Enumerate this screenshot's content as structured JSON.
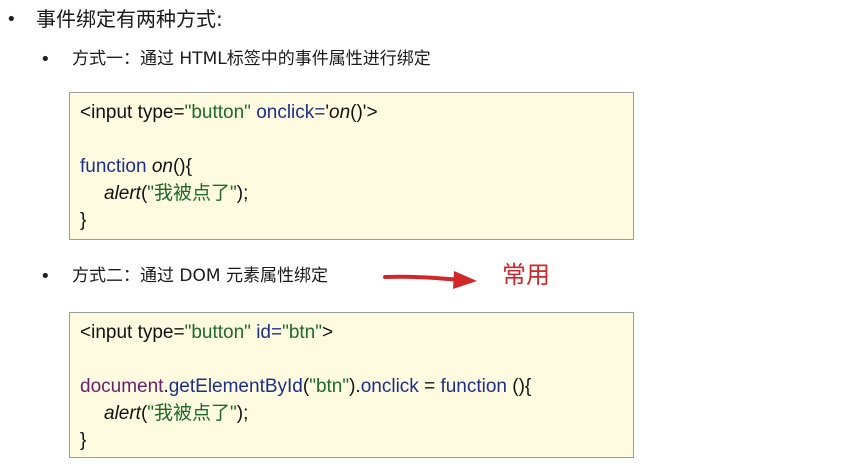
{
  "heading": "事件绑定有两种方式:",
  "method1": {
    "title": "方式一：通过 HTML标签中的事件属性进行绑定",
    "code": {
      "l1_a": "<input type=",
      "l1_b": "\"button\"",
      "l1_c": " onclick=",
      "l1_d": "'",
      "l1_e": "on",
      "l1_f": "()'",
      "l1_g": ">",
      "l3_a": "function ",
      "l3_b": "on",
      "l3_c": "(){",
      "l4_a": "alert",
      "l4_b": "(",
      "l4_c": "\"我被点了\"",
      "l4_d": ");",
      "l5": "}"
    }
  },
  "method2": {
    "title": "方式二：通过 DOM 元素属性绑定",
    "tag": "常用",
    "code": {
      "l1_a": "<input type=",
      "l1_b": "\"button\"",
      "l1_c": " id=",
      "l1_d": "\"btn\"",
      "l1_e": ">",
      "l3_a": "document",
      "l3_b": ".",
      "l3_c": "getElementById",
      "l3_d": "(",
      "l3_e": "\"btn\"",
      "l3_f": ").",
      "l3_g": "onclick",
      "l3_h": " = ",
      "l3_i": "function ",
      "l3_j": "(){",
      "l4_a": "alert",
      "l4_b": "(",
      "l4_c": "\"我被点了\"",
      "l4_d": ");",
      "l5": "}"
    }
  },
  "icons": {
    "bullet": "bullet-dot",
    "arrow": "right-arrow-icon"
  },
  "colors": {
    "code_background": "#fffbe0",
    "keyword": "#1d2f8c",
    "string": "#1b6b2b",
    "highlight": "#d1272a"
  }
}
